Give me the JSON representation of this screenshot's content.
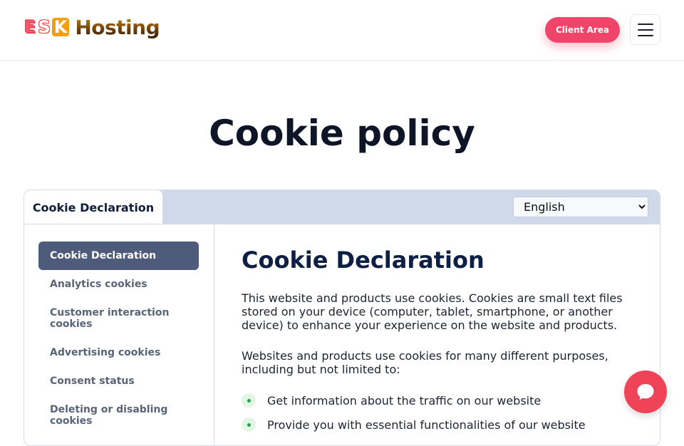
{
  "brand": {
    "logo_letters": [
      "E",
      "S",
      "K"
    ],
    "logo_word": "Hosting",
    "accent_color": "#f0446a"
  },
  "header": {
    "client_area_label": "Client Area",
    "menu_icon": "hamburger-icon"
  },
  "page": {
    "title": "Cookie policy"
  },
  "cookie_panel": {
    "tab_label": "Cookie Declaration",
    "language_selected": "English",
    "sidebar": [
      {
        "label": "Cookie Declaration",
        "active": true
      },
      {
        "label": "Analytics cookies",
        "active": false
      },
      {
        "label": "Customer interaction cookies",
        "active": false
      },
      {
        "label": "Advertising cookies",
        "active": false
      },
      {
        "label": "Consent status",
        "active": false
      },
      {
        "label": "Deleting or disabling cookies",
        "active": false
      }
    ],
    "heading": "Cookie Declaration",
    "paragraphs": [
      "This website and products use cookies. Cookies are small text files stored on your device (computer, tablet, smartphone, or another device) to enhance your experience on the website and products.",
      "Websites and products use cookies for many different purposes, including but not limited to:"
    ],
    "bullets": [
      "Get information about the traffic on our website",
      "Provide you with essential functionalities of our website"
    ]
  },
  "chat": {
    "icon": "chat-bubble-icon"
  }
}
